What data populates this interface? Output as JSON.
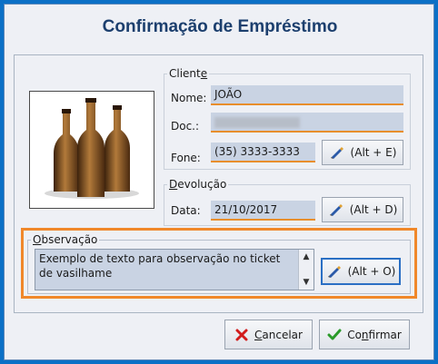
{
  "window": {
    "title": "Confirmação de Empréstimo"
  },
  "cliente": {
    "legend_pre": "Client",
    "legend_key": "e",
    "nome_label": "Nome:",
    "nome_value": "JOÃO",
    "doc_label": "Doc.:",
    "doc_value": "",
    "fone_label": "Fone:",
    "fone_value": "(35) 3333-3333",
    "fone_button": "(Alt + E)"
  },
  "devolucao": {
    "legend_key": "D",
    "legend_rest": "evolução",
    "data_label": "Data:",
    "data_value": "21/10/2017",
    "data_button": "(Alt + D)"
  },
  "observacao": {
    "legend_key": "O",
    "legend_rest": "bservação",
    "text": "Exemplo de texto para observação no ticket de vasilhame",
    "button": "(Alt + O)"
  },
  "footer": {
    "cancel_key": "C",
    "cancel_rest": "ancelar",
    "confirm_pre": "Co",
    "confirm_key": "n",
    "confirm_rest": "firmar"
  },
  "colors": {
    "accent_orange": "#f0882a",
    "field_bg": "#c9d3e3",
    "title": "#1c3f6e"
  }
}
